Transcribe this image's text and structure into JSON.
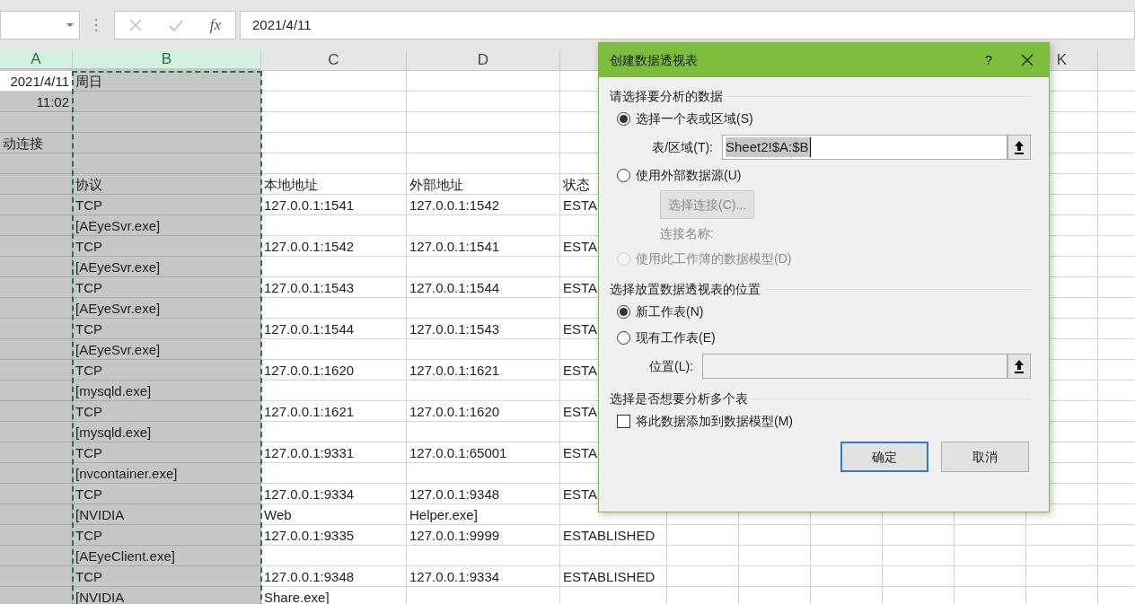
{
  "formula_bar": {
    "function_label": "fx",
    "formula": "2021/4/11"
  },
  "columns": [
    {
      "label": "A",
      "selected": true,
      "copied": false
    },
    {
      "label": "B",
      "selected": true,
      "copied": true
    },
    {
      "label": "C",
      "selected": false,
      "copied": false
    },
    {
      "label": "D",
      "selected": false,
      "copied": false
    },
    {},
    {},
    {},
    {},
    {},
    {},
    {
      "label": "K",
      "selected": false,
      "copied": false
    },
    {}
  ],
  "rows": [
    {
      "cells": {
        "A": {
          "text": "2021/4/11",
          "kind": "number",
          "active": true
        },
        "B": "周日"
      }
    },
    {
      "cells": {
        "A": {
          "text": "11:02",
          "kind": "number",
          "active": false
        }
      }
    },
    {
      "cells": {}
    },
    {
      "cells": {
        "A": {
          "text": "动连接",
          "kind": "text",
          "active": false
        }
      }
    },
    {
      "cells": {}
    },
    {
      "cells": {
        "B": "协议",
        "C": "本地地址",
        "D": "外部地址",
        "E": "状态"
      }
    },
    {
      "cells": {
        "B": "TCP",
        "C": "127.0.0.1:1541",
        "D": "127.0.0.1:1542",
        "E": "ESTA"
      }
    },
    {
      "cells": {
        "B": "[AEyeSvr.exe]"
      }
    },
    {
      "cells": {
        "B": "TCP",
        "C": "127.0.0.1:1542",
        "D": "127.0.0.1:1541",
        "E": "ESTA"
      }
    },
    {
      "cells": {
        "B": "[AEyeSvr.exe]"
      }
    },
    {
      "cells": {
        "B": "TCP",
        "C": "127.0.0.1:1543",
        "D": "127.0.0.1:1544",
        "E": "ESTA"
      }
    },
    {
      "cells": {
        "B": "[AEyeSvr.exe]"
      }
    },
    {
      "cells": {
        "B": "TCP",
        "C": "127.0.0.1:1544",
        "D": "127.0.0.1:1543",
        "E": "ESTA"
      }
    },
    {
      "cells": {
        "B": "[AEyeSvr.exe]"
      }
    },
    {
      "cells": {
        "B": "TCP",
        "C": "127.0.0.1:1620",
        "D": "127.0.0.1:1621",
        "E": "ESTA"
      }
    },
    {
      "cells": {
        "B": "[mysqld.exe]"
      }
    },
    {
      "cells": {
        "B": "TCP",
        "C": "127.0.0.1:1621",
        "D": "127.0.0.1:1620",
        "E": "ESTA"
      }
    },
    {
      "cells": {
        "B": "[mysqld.exe]"
      }
    },
    {
      "cells": {
        "B": "TCP",
        "C": "127.0.0.1:9331",
        "D": "127.0.0.1:65001",
        "E": "ESTA"
      }
    },
    {
      "cells": {
        "B": "[nvcontainer.exe]"
      }
    },
    {
      "cells": {
        "B": "TCP",
        "C": "127.0.0.1:9334",
        "D": "127.0.0.1:9348",
        "E": "ESTA"
      }
    },
    {
      "cells": {
        "B": "[NVIDIA",
        "C": "Web",
        "D": "Helper.exe]"
      }
    },
    {
      "cells": {
        "B": "TCP",
        "C": "127.0.0.1:9335",
        "D": "127.0.0.1:9999",
        "E": "ESTABLISHED"
      }
    },
    {
      "cells": {
        "B": "[AEyeClient.exe]"
      }
    },
    {
      "cells": {
        "B": "TCP",
        "C": "127.0.0.1:9348",
        "D": "127.0.0.1:9334",
        "E": "ESTABLISHED"
      }
    },
    {
      "cells": {
        "B": "[NVIDIA",
        "C": "Share.exe]"
      }
    }
  ],
  "dialog": {
    "title": "创建数据透视表",
    "help": "?",
    "sections": [
      {
        "title": "请选择要分析的数据",
        "items": [
          {
            "kind": "radio",
            "label": "选择一个表或区域(S)",
            "selected": true,
            "disabled": false
          },
          {
            "kind": "field",
            "label": "表/区域(T):",
            "value": "Sheet2!$A:$B",
            "disabled": false
          },
          {
            "kind": "radio",
            "label": "使用外部数据源(U)",
            "selected": false,
            "disabled": false
          },
          {
            "kind": "button",
            "label": "选择连接(C)...",
            "disabled": true
          },
          {
            "kind": "note",
            "label": "连接名称:",
            "disabled": true
          },
          {
            "kind": "radio",
            "label": "使用此工作簿的数据模型(D)",
            "selected": false,
            "disabled": true
          }
        ]
      },
      {
        "title": "选择放置数据透视表的位置",
        "items": [
          {
            "kind": "radio",
            "label": "新工作表(N)",
            "selected": true,
            "disabled": false
          },
          {
            "kind": "radio",
            "label": "现有工作表(E)",
            "selected": false,
            "disabled": false
          },
          {
            "kind": "field",
            "label": "位置(L):",
            "disabled": true
          }
        ]
      },
      {
        "title": "选择是否想要分析多个表",
        "items": [
          {
            "kind": "checkbox",
            "label": "将此数据添加到数据模型(M)",
            "checked": false,
            "disabled": false
          }
        ]
      }
    ],
    "buttons": [
      {
        "label": "确定",
        "default": true
      },
      {
        "label": "取消",
        "default": false
      }
    ]
  }
}
